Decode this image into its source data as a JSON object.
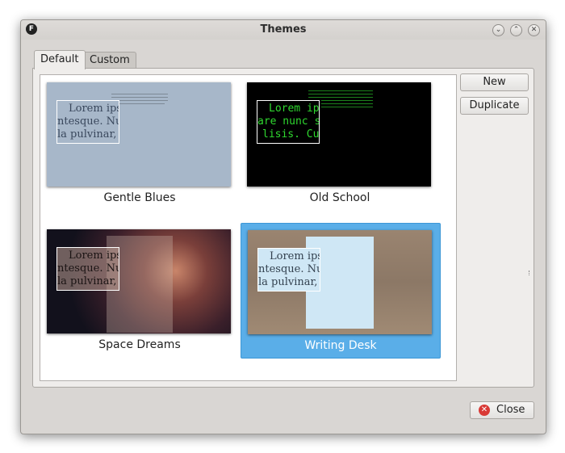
{
  "window": {
    "title": "Themes",
    "app_icon": "F",
    "controls": {
      "minimize": "⌄",
      "maximize": "⌃",
      "close": "✕"
    }
  },
  "tabs": [
    {
      "label": "Default",
      "active": true
    },
    {
      "label": "Custom",
      "active": false
    }
  ],
  "themes": [
    {
      "name": "Gentle Blues",
      "sample_text": [
        "Lorem ipsu",
        "ntesque. Nulla",
        "la pulvinar, V"
      ],
      "selected": false,
      "background": "#a7b7c9",
      "text_color": "#39475c"
    },
    {
      "name": "Old School",
      "sample_text": [
        "Lorem ip",
        "are nunc s",
        "lisis. Cu"
      ],
      "selected": false,
      "background": "#000000",
      "text_color": "#2fd82f"
    },
    {
      "name": "Space Dreams",
      "sample_text": [
        "Lorem ipsu",
        "ntesque. Nulla",
        "la pulvinar, V"
      ],
      "selected": false,
      "background": "#3a2424",
      "text_color": "#1b1414"
    },
    {
      "name": "Writing Desk",
      "sample_text": [
        "Lorem ipsu",
        "ntesque. Nulla",
        "la pulvinar, V"
      ],
      "selected": true,
      "background": "#8f7a66",
      "text_color": "#33414f"
    }
  ],
  "buttons": {
    "new": "New",
    "duplicate": "Duplicate",
    "close": "Close"
  },
  "icons": {
    "close_button_icon": "close-icon",
    "app": "focuswriter-icon"
  }
}
